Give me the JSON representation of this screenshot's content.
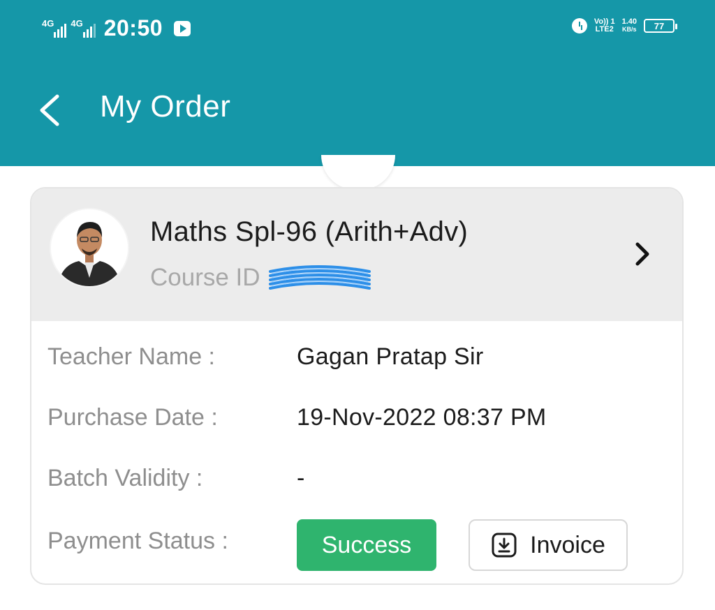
{
  "status_bar": {
    "network1": "4G",
    "network2": "4G",
    "time": "20:50",
    "volte_line1": "Vo)) 1",
    "volte_line2": "LTE2",
    "speed_value": "1.40",
    "speed_unit": "KB/s",
    "battery": "77"
  },
  "header": {
    "title": "My Order",
    "bg_color": "#1597a8"
  },
  "order": {
    "course_name": "Maths Spl-96 (Arith+Adv)",
    "course_id_label": "Course ID",
    "teacher_label": "Teacher Name :",
    "teacher_value": "Gagan Pratap Sir",
    "purchase_label": "Purchase Date :",
    "purchase_value": "19-Nov-2022 08:37 PM",
    "validity_label": "Batch Validity :",
    "validity_value": "-",
    "payment_label": "Payment Status :",
    "payment_status": "Success",
    "invoice_label": "Invoice",
    "success_color": "#2fb46e"
  },
  "icons": {
    "back": "back-arrow-icon",
    "open": "chevron-right-icon",
    "download": "download-icon"
  }
}
